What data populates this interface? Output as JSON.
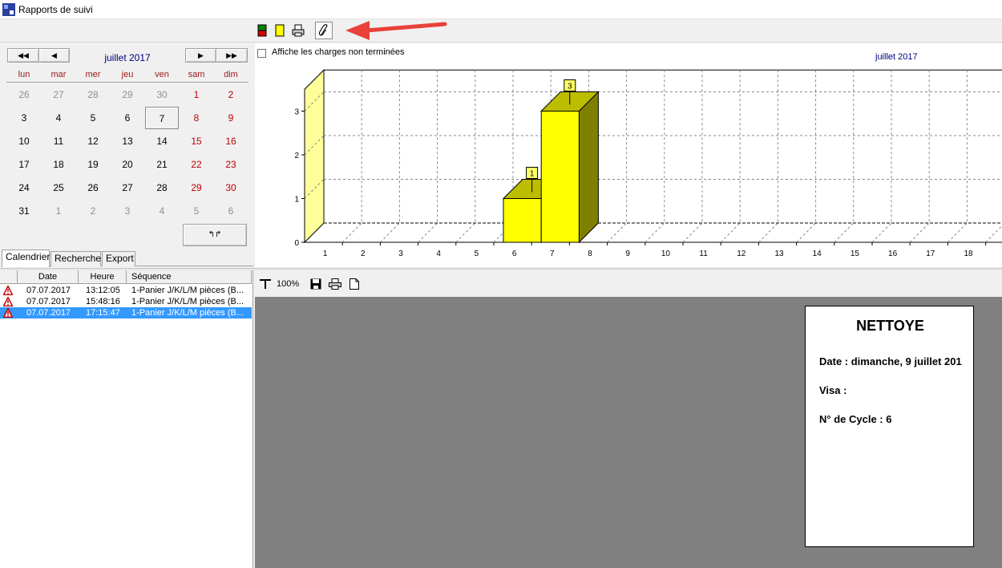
{
  "window": {
    "title": "Rapports de suivi"
  },
  "toolbar": {
    "buttons": [
      {
        "icon": "red-green-chart-icon"
      },
      {
        "icon": "yellow-chart-icon"
      },
      {
        "icon": "printer-icon"
      },
      {
        "icon": "paperclip-icon",
        "active": true
      }
    ]
  },
  "calendar": {
    "month_label": "juillet 2017",
    "nav": {
      "prev_year": "◀◀",
      "prev_month": "◀",
      "next_month": "▶",
      "next_year": "▶▶"
    },
    "weekdays": [
      "lun",
      "mar",
      "mer",
      "jeu",
      "ven",
      "sam",
      "dim"
    ],
    "weeks": [
      [
        "26",
        "27",
        "28",
        "29",
        "30",
        "1",
        "2"
      ],
      [
        "3",
        "4",
        "5",
        "6",
        "7",
        "8",
        "9"
      ],
      [
        "10",
        "11",
        "12",
        "13",
        "14",
        "15",
        "16"
      ],
      [
        "17",
        "18",
        "19",
        "20",
        "21",
        "22",
        "23"
      ],
      [
        "24",
        "25",
        "26",
        "27",
        "28",
        "29",
        "30"
      ],
      [
        "31",
        "1",
        "2",
        "3",
        "4",
        "5",
        "6"
      ]
    ],
    "selected_day": "7",
    "today_button": "↰↱"
  },
  "tabs": [
    "Calendrier",
    "Recherche",
    "Export"
  ],
  "active_tab": "Calendrier",
  "chart_panel": {
    "checkbox_label": "Affiche les charges non terminées",
    "checkbox_checked": false,
    "month_label": "juillet 2017"
  },
  "chart_data": {
    "type": "bar",
    "categories": [
      "1",
      "2",
      "3",
      "4",
      "5",
      "6",
      "7",
      "8",
      "9",
      "10",
      "11",
      "12",
      "13",
      "14",
      "15",
      "16",
      "17",
      "18"
    ],
    "values": [
      0,
      0,
      0,
      0,
      0,
      1,
      3,
      0,
      0,
      0,
      0,
      0,
      0,
      0,
      0,
      0,
      0,
      0
    ],
    "data_labels": {
      "6": "1",
      "7": "3"
    },
    "yticks": [
      "0",
      "1",
      "2",
      "3"
    ],
    "ylim": [
      0,
      3.5
    ],
    "grid": true,
    "style": "3d",
    "colors": {
      "front": "#ffff00",
      "top": "#bdbd00",
      "side": "#808000",
      "wall": "#ffff99"
    }
  },
  "list": {
    "columns": [
      "",
      "Date",
      "Heure",
      "Séquence"
    ],
    "rows": [
      {
        "icon": "warning-icon",
        "date": "07.07.2017",
        "time": "13:12:05",
        "sequence": "1-Panier J/K/L/M pièces (B...",
        "selected": false
      },
      {
        "icon": "warning-icon",
        "date": "07.07.2017",
        "time": "15:48:16",
        "sequence": "1-Panier J/K/L/M pièces (B...",
        "selected": false
      },
      {
        "icon": "warning-icon",
        "date": "07.07.2017",
        "time": "17:15:47",
        "sequence": "1-Panier J/K/L/M pièces (B...",
        "selected": true
      }
    ]
  },
  "preview": {
    "zoom": "100%",
    "toolbar_icons": [
      "zoom-icon",
      "save-icon",
      "print-icon",
      "page-icon"
    ],
    "document": {
      "title": "NETTOYE",
      "lines": [
        "Date : dimanche, 9 juillet 201",
        "Visa :",
        "N° de Cycle : 6"
      ]
    }
  },
  "colors": {
    "accent": "#3399ff",
    "weekend": "#c00000",
    "month": "#00007f",
    "arrow": "#e8413a"
  }
}
